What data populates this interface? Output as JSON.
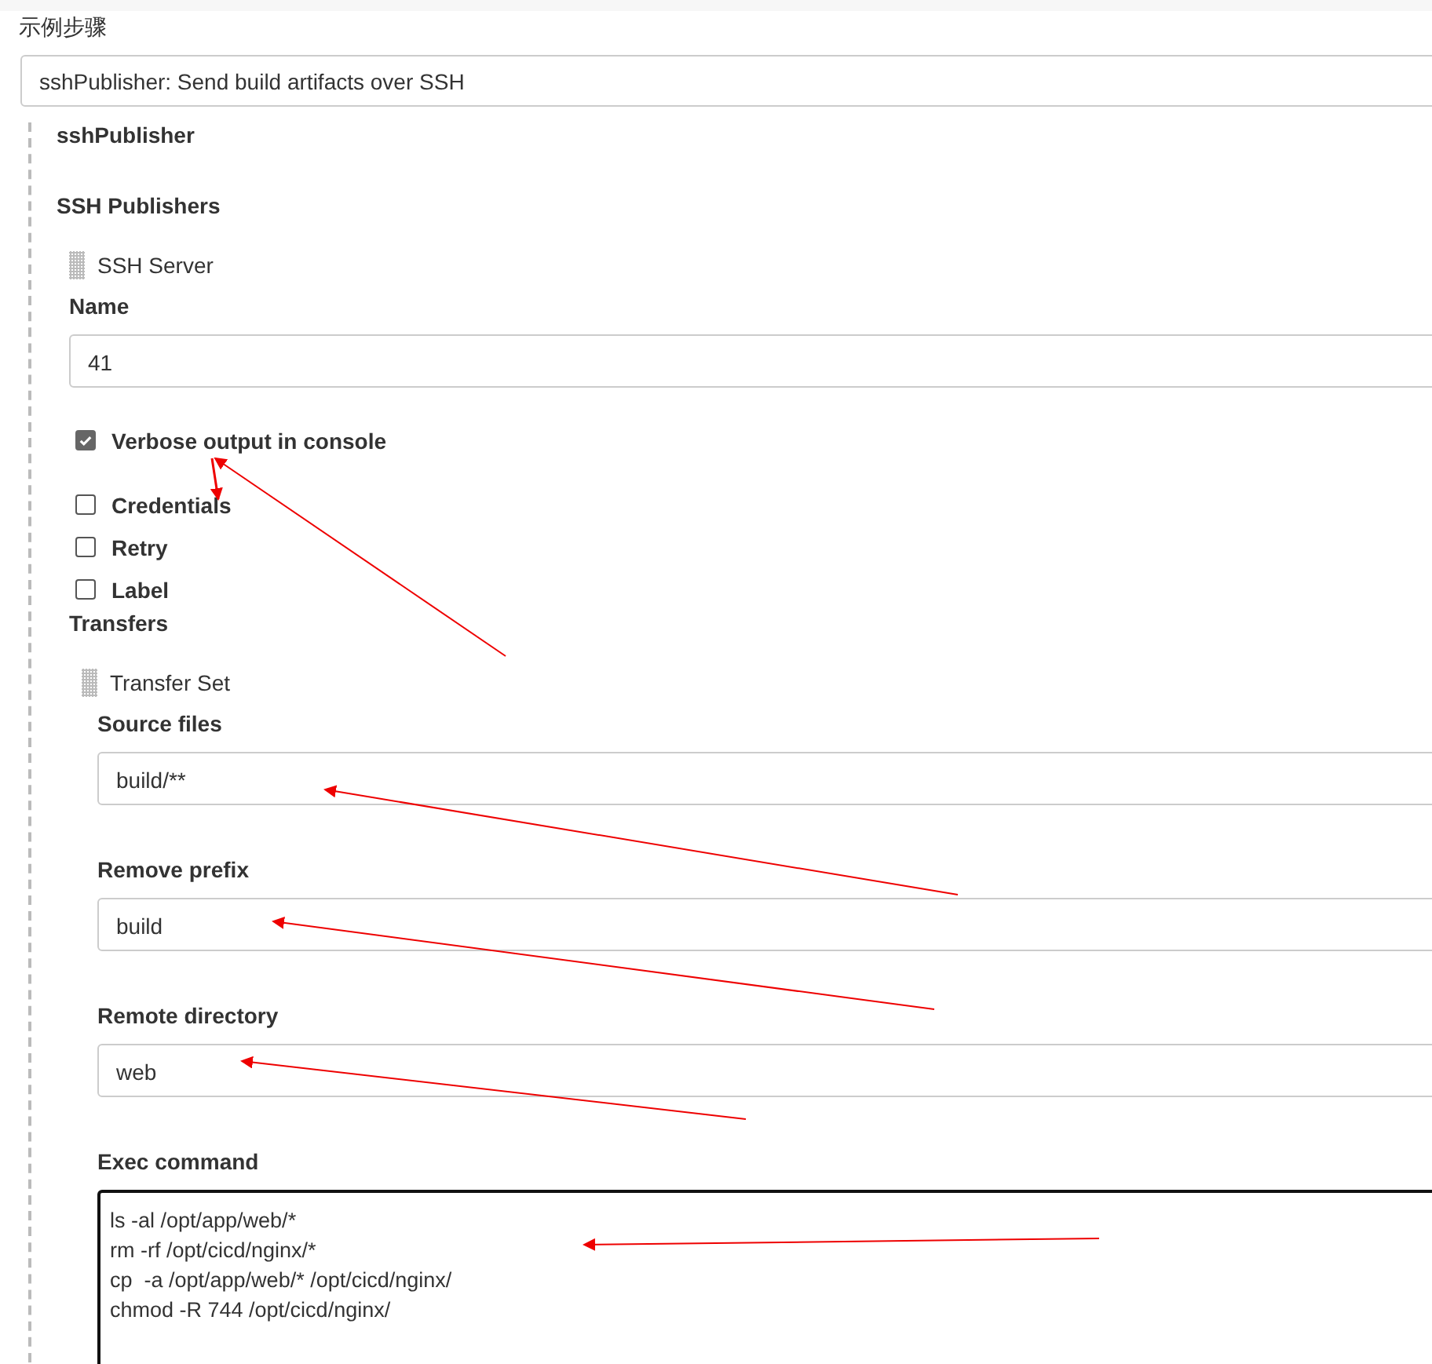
{
  "step_label": "示例步骤",
  "step_select": {
    "value": "sshPublisher: Send build artifacts over SSH"
  },
  "section_title": "sshPublisher",
  "publishers_title": "SSH Publishers",
  "server": {
    "title": "SSH Server",
    "name_label": "Name",
    "name_value": "41",
    "options": [
      {
        "label": "Verbose output in console",
        "checked": true
      },
      {
        "label": "Credentials",
        "checked": false
      },
      {
        "label": "Retry",
        "checked": false
      },
      {
        "label": "Label",
        "checked": false
      }
    ],
    "transfers_label": "Transfers",
    "transfer_set": {
      "title": "Transfer Set",
      "fields": [
        {
          "label": "Source files",
          "value": "build/**"
        },
        {
          "label": "Remove prefix",
          "value": "build"
        },
        {
          "label": "Remote directory",
          "value": "web"
        }
      ],
      "exec": {
        "label": "Exec command",
        "lines": [
          "ls -al /opt/app/web/*",
          "rm -rf /opt/cicd/nginx/*",
          "cp  -a /opt/app/web/* /opt/cicd/nginx/",
          "chmod -R 744 /opt/cicd/nginx/"
        ]
      }
    }
  }
}
